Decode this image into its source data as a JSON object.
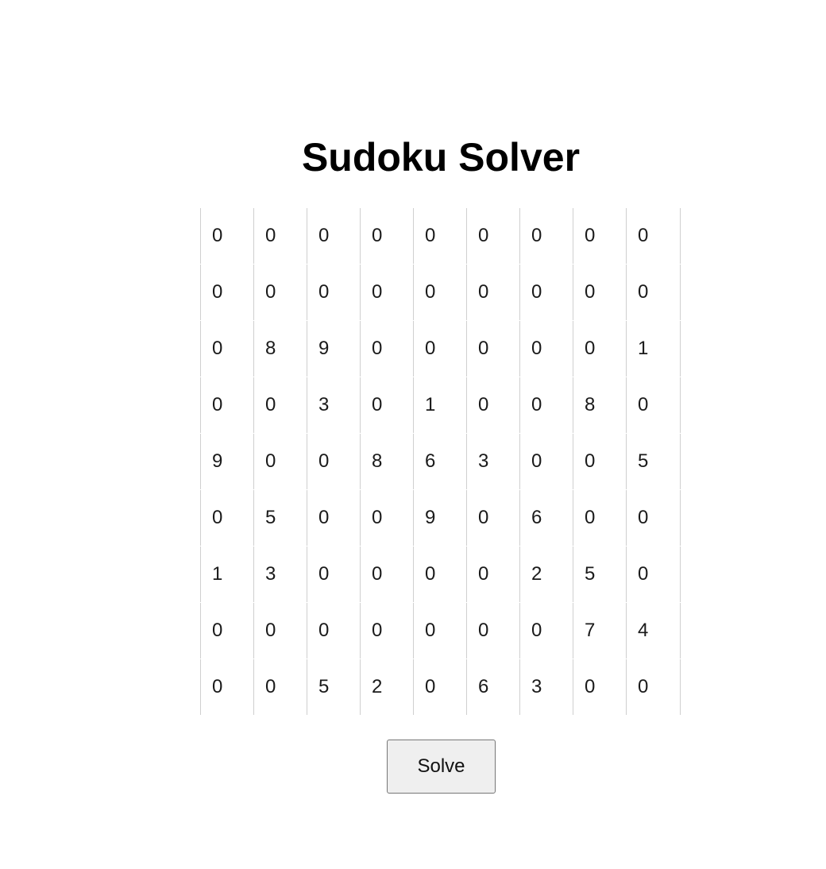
{
  "page": {
    "title": "Sudoku Solver"
  },
  "grid": {
    "rows": [
      [
        "0",
        "0",
        "0",
        "0",
        "0",
        "0",
        "0",
        "0",
        "0"
      ],
      [
        "0",
        "0",
        "0",
        "0",
        "0",
        "0",
        "0",
        "0",
        "0"
      ],
      [
        "0",
        "8",
        "9",
        "0",
        "0",
        "0",
        "0",
        "0",
        "1"
      ],
      [
        "0",
        "0",
        "3",
        "0",
        "1",
        "0",
        "0",
        "8",
        "0"
      ],
      [
        "9",
        "0",
        "0",
        "8",
        "6",
        "3",
        "0",
        "0",
        "5"
      ],
      [
        "0",
        "5",
        "0",
        "0",
        "9",
        "0",
        "6",
        "0",
        "0"
      ],
      [
        "1",
        "3",
        "0",
        "0",
        "0",
        "0",
        "2",
        "5",
        "0"
      ],
      [
        "0",
        "0",
        "0",
        "0",
        "0",
        "0",
        "0",
        "7",
        "4"
      ],
      [
        "0",
        "0",
        "5",
        "2",
        "0",
        "6",
        "3",
        "0",
        "0"
      ]
    ]
  },
  "actions": {
    "solve_label": "Solve"
  }
}
